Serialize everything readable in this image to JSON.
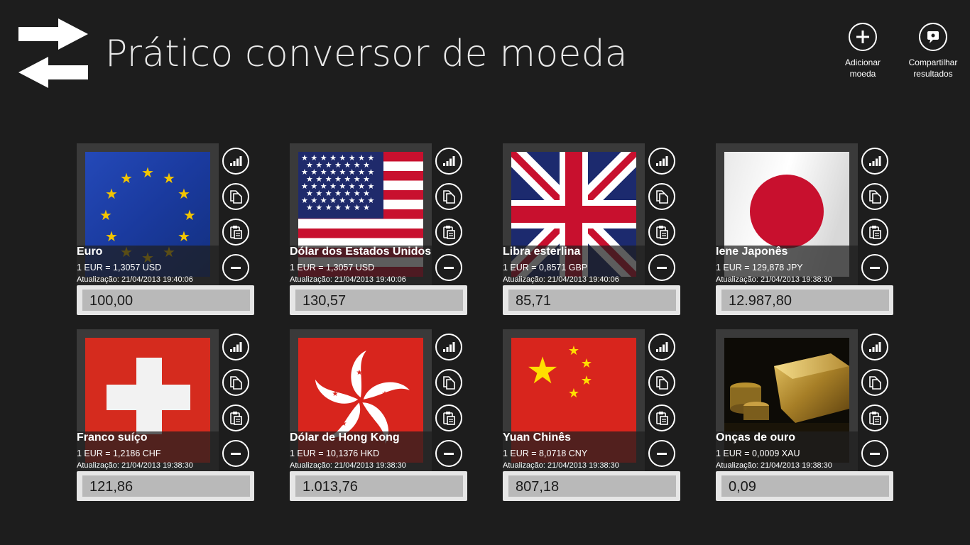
{
  "app": {
    "title": "Prático conversor de moeda",
    "icon": "swap-arrows-icon"
  },
  "appbar": {
    "add_label_1": "Adicionar",
    "add_label_2": "moeda",
    "share_label_1": "Compartilhar",
    "share_label_2": "resultados"
  },
  "tile_actions": [
    "chart-icon",
    "copy-icon",
    "paste-icon",
    "remove-icon"
  ],
  "currencies": [
    {
      "name": "Euro",
      "rate": "1 EUR = 1,3057 USD",
      "updated": "Atualização: 21/04/2013 19:40:06",
      "amount": "100,00",
      "flag": "eu-flag"
    },
    {
      "name": "Dólar dos Estados Unidos",
      "rate": "1 EUR = 1,3057 USD",
      "updated": "Atualização: 21/04/2013 19:40:06",
      "amount": "130,57",
      "flag": "us-flag"
    },
    {
      "name": "Libra esterlina",
      "rate": "1 EUR = 0,8571 GBP",
      "updated": "Atualização: 21/04/2013 19:40:06",
      "amount": "85,71",
      "flag": "uk-flag"
    },
    {
      "name": "Iene Japonês",
      "rate": "1 EUR = 129,878 JPY",
      "updated": "Atualização: 21/04/2013 19:38:30",
      "amount": "12.987,80",
      "flag": "japan-flag"
    },
    {
      "name": "Franco suíço",
      "rate": "1 EUR = 1,2186 CHF",
      "updated": "Atualização: 21/04/2013 19:38:30",
      "amount": "121,86",
      "flag": "swiss-flag"
    },
    {
      "name": "Dólar de Hong Kong",
      "rate": "1 EUR = 10,1376 HKD",
      "updated": "Atualização: 21/04/2013 19:38:30",
      "amount": "1.013,76",
      "flag": "hongkong-flag"
    },
    {
      "name": "Yuan Chinês",
      "rate": "1 EUR = 8,0718 CNY",
      "updated": "Atualização: 21/04/2013 19:38:30",
      "amount": "807,18",
      "flag": "china-flag"
    },
    {
      "name": "Onças de ouro",
      "rate": "1 EUR = 0,0009 XAU",
      "updated": "Atualização: 21/04/2013 19:38:30",
      "amount": "0,09",
      "flag": "gold-bars-image"
    }
  ],
  "colors": {
    "background": "#1d1d1d",
    "tile_frame": "#3a3a3a",
    "amount_field": "#b9b9b9"
  }
}
